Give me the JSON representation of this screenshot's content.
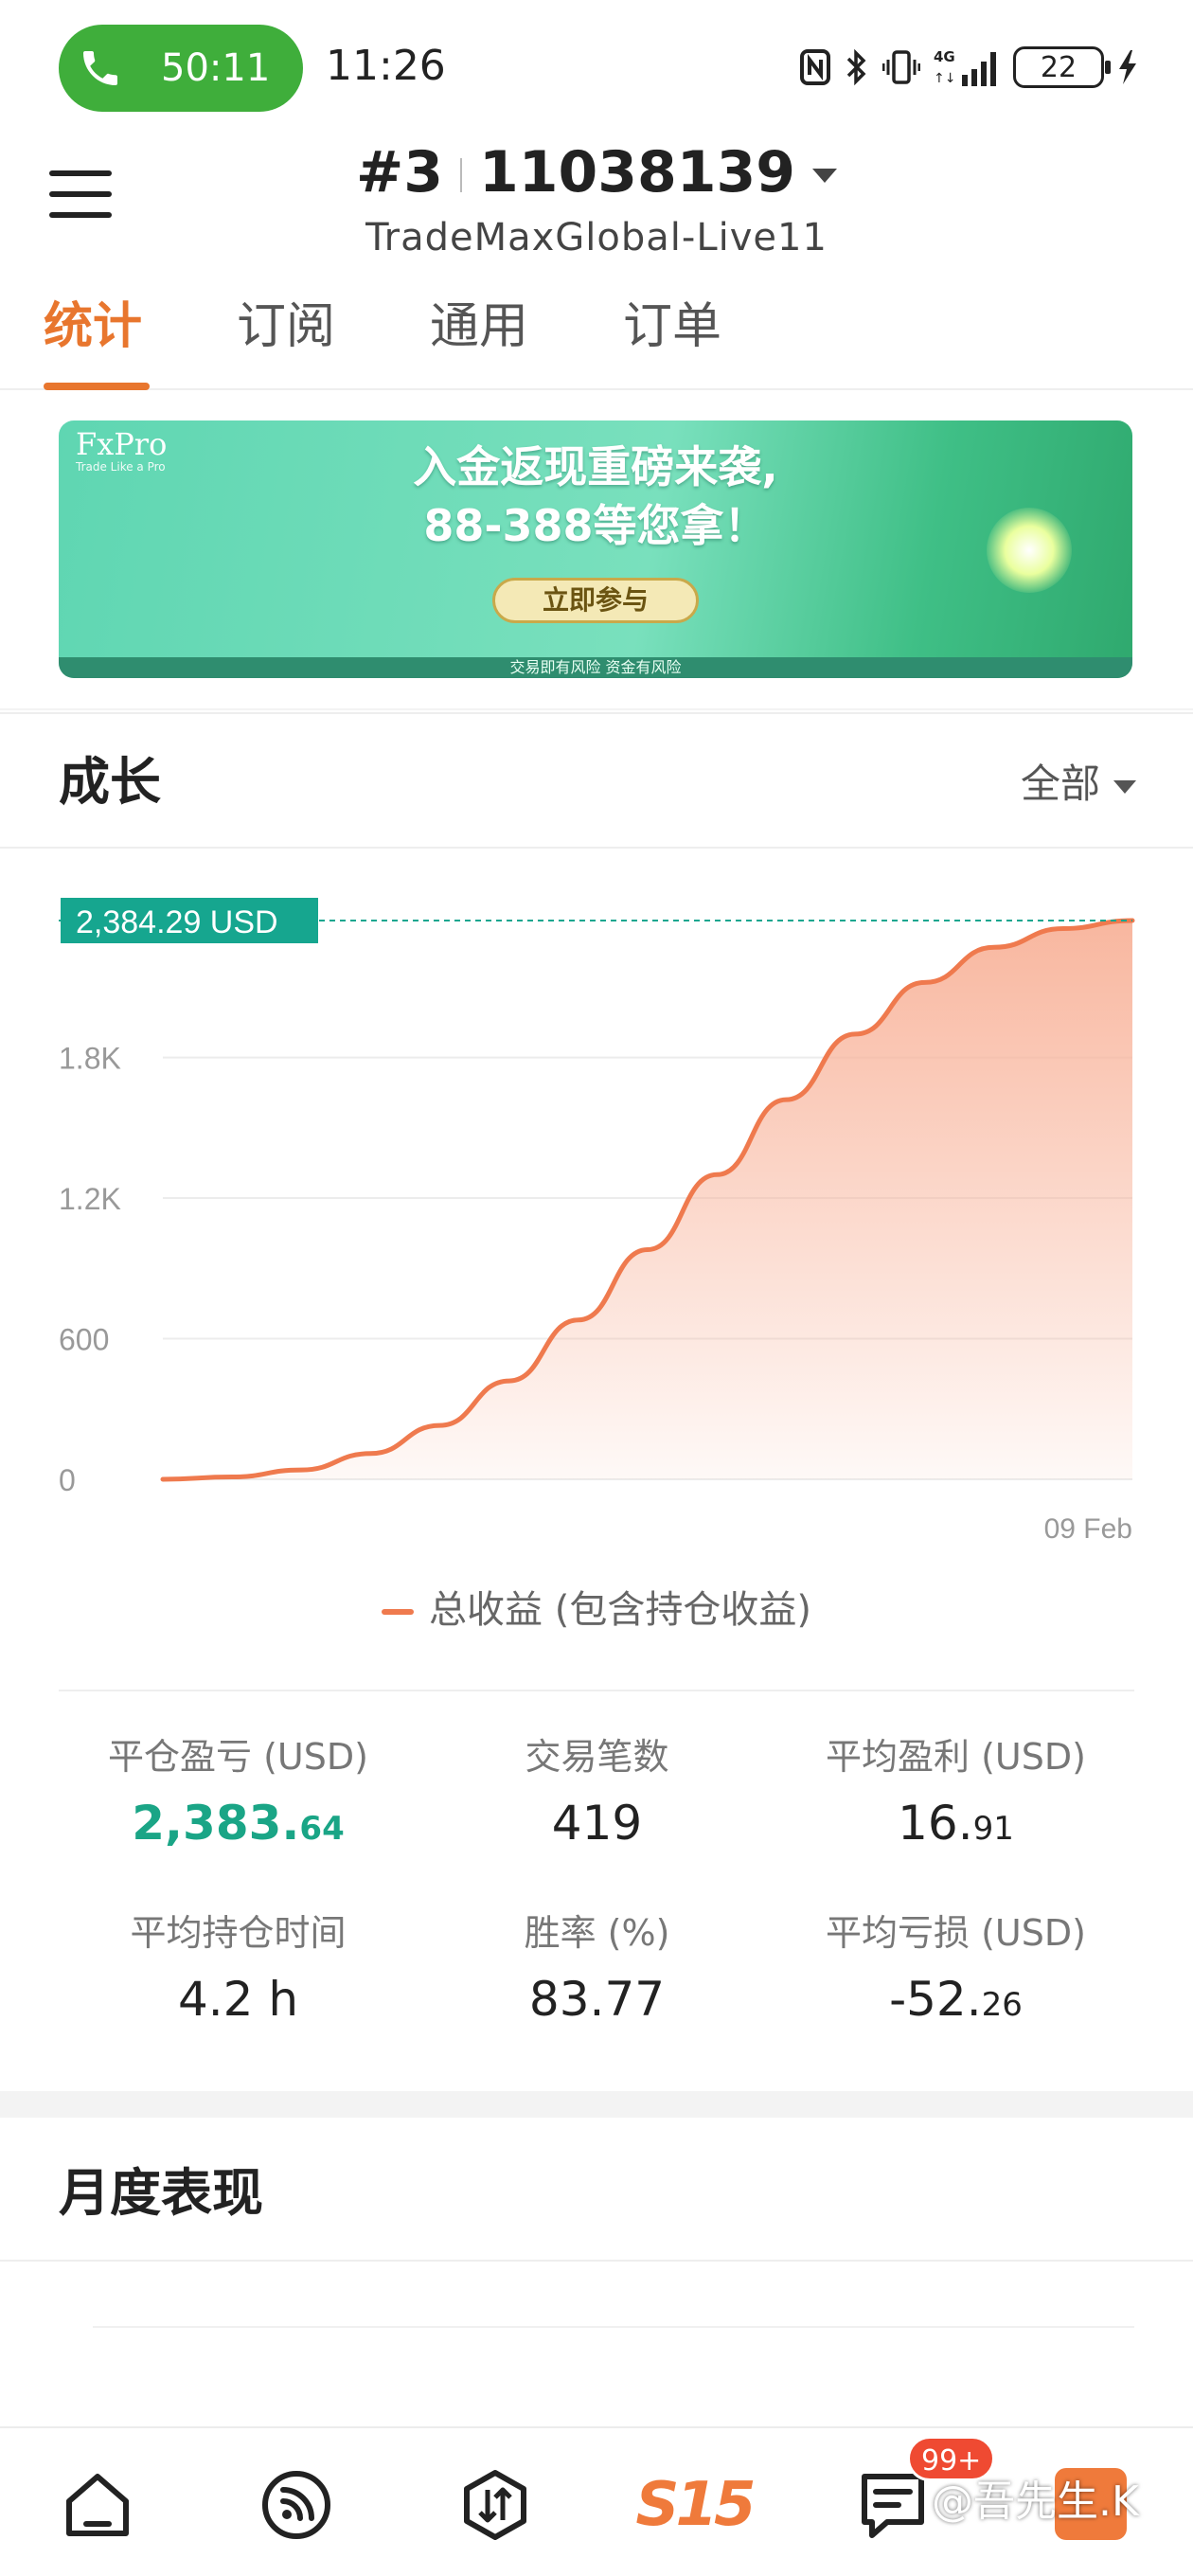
{
  "status_bar": {
    "call_timer": "50:11",
    "clock": "11:26",
    "battery": "22",
    "network": "4G",
    "icons": [
      "phone-icon",
      "nfc-icon",
      "bluetooth-icon",
      "vibrate-icon",
      "signal-icon",
      "battery-icon",
      "charging-icon"
    ]
  },
  "header": {
    "account_index": "#3",
    "account_number": "11038139",
    "server": "TradeMaxGlobal-Live11"
  },
  "tabs": [
    {
      "label": "统计",
      "active": true
    },
    {
      "label": "订阅",
      "active": false
    },
    {
      "label": "通用",
      "active": false
    },
    {
      "label": "订单",
      "active": false
    }
  ],
  "banner": {
    "logo": "FxPro",
    "logo_tagline": "Trade Like a Pro",
    "headline_1": "入金返现重磅来袭,",
    "headline_2": "88-388等您拿！",
    "cta": "立即参与",
    "disclaimer": "交易即有风险 资金有风险"
  },
  "growth": {
    "title": "成长",
    "range": "全部",
    "current_value_label": "2,384.29 USD",
    "legend": "总收益 (包含持仓收益)"
  },
  "chart_data": {
    "type": "area",
    "series": [
      {
        "name": "总收益 (包含持仓收益)",
        "values": [
          0,
          10,
          40,
          110,
          230,
          420,
          680,
          980,
          1300,
          1620,
          1900,
          2120,
          2270,
          2350,
          2384.29
        ]
      }
    ],
    "yticks": [
      "0",
      "600",
      "1.2K",
      "1.8K"
    ],
    "ytick_values": [
      0,
      600,
      1200,
      1800
    ],
    "xticks": [
      "09 Feb"
    ],
    "ylim": [
      0,
      2384.29
    ],
    "grid": true,
    "line_color": "#ef7a4e",
    "fill_color": "#f8b39a",
    "marker_color": "#16a68f"
  },
  "stats": [
    {
      "label": "平仓盈亏 (USD)",
      "value_main": "2,383.",
      "value_dec": "64",
      "color": "green"
    },
    {
      "label": "交易笔数",
      "value_main": "419",
      "value_dec": "",
      "color": "default"
    },
    {
      "label": "平均盈利 (USD)",
      "value_main": "16.",
      "value_dec": "91",
      "color": "default"
    },
    {
      "label": "平均持仓时间",
      "value_main": "4.2 h",
      "value_dec": "",
      "color": "default"
    },
    {
      "label": "胜率 (%)",
      "value_main": "83.77",
      "value_dec": "",
      "color": "default"
    },
    {
      "label": "平均亏损 (USD)",
      "value_main": "-52.",
      "value_dec": "26",
      "color": "default"
    }
  ],
  "monthly": {
    "title": "月度表现"
  },
  "bottom_nav": {
    "items": [
      "home-icon",
      "signals-icon",
      "trade-icon",
      "s15-logo",
      "messages-icon",
      "profile-icon"
    ],
    "s15_label": "S15",
    "badge": "99+",
    "watermark": "@吾先生.K"
  }
}
